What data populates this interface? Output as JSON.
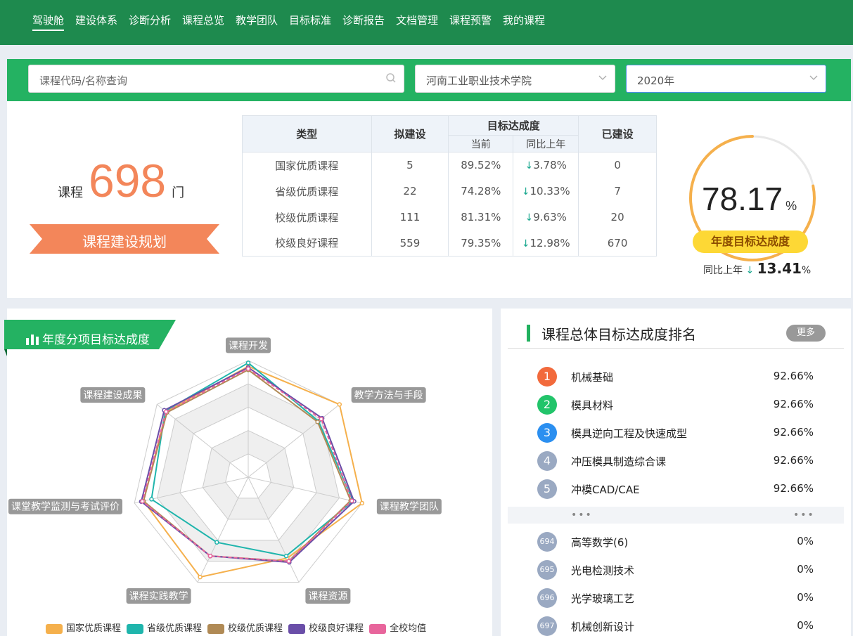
{
  "nav": {
    "items": [
      "驾驶舱",
      "建设体系",
      "诊断分析",
      "课程总览",
      "教学团队",
      "目标标准",
      "诊断报告",
      "文档管理",
      "课程预警",
      "我的课程"
    ]
  },
  "filters": {
    "search_placeholder": "课程代码/名称查询",
    "school": "河南工业职业技术学院",
    "year": "2020年"
  },
  "summary": {
    "label_prefix": "课程",
    "count": "698",
    "label_suffix": "门",
    "plan_button": "课程建设规划"
  },
  "table": {
    "headers": {
      "type": "类型",
      "planned": "拟建设",
      "goal": "目标达成度",
      "current": "当前",
      "yoy": "同比上年",
      "built": "已建设"
    },
    "rows": [
      {
        "type": "国家优质课程",
        "planned": "5",
        "current": "89.52%",
        "yoy": "3.78%",
        "built": "0"
      },
      {
        "type": "省级优质课程",
        "planned": "22",
        "current": "74.28%",
        "yoy": "10.33%",
        "built": "7"
      },
      {
        "type": "校级优质课程",
        "planned": "111",
        "current": "81.31%",
        "yoy": "9.63%",
        "built": "20"
      },
      {
        "type": "校级良好课程",
        "planned": "559",
        "current": "79.35%",
        "yoy": "12.98%",
        "built": "670"
      }
    ]
  },
  "gauge": {
    "value": "78.17",
    "unit": "%",
    "fraction": 0.7817,
    "label": "年度目标达成度",
    "yoy_label": "同比上年",
    "yoy_value": "13.41",
    "yoy_unit": "%"
  },
  "radar": {
    "title": "年度分项目标达成度"
  },
  "chart_data": {
    "type": "radar",
    "title": "年度分项目标达成度",
    "indicators": [
      "课程开发",
      "教学方法与手段",
      "课程教学团队",
      "课程资源",
      "课程实践教学",
      "课堂教学监测与考试评价",
      "课程建设成果"
    ],
    "max": 100,
    "series": [
      {
        "name": "国家优质课程",
        "color": "#f5b04c",
        "values": [
          95,
          100,
          100,
          77,
          95,
          92,
          90
        ]
      },
      {
        "name": "省级优质课程",
        "color": "#1fb5ac",
        "values": [
          98,
          77,
          92,
          75,
          62,
          85,
          91
        ]
      },
      {
        "name": "校级优质课程",
        "color": "#b08a55",
        "values": [
          92,
          76,
          90,
          80,
          75,
          92,
          89
        ]
      },
      {
        "name": "校级良好课程",
        "color": "#6a4ea8",
        "values": [
          94,
          81,
          93,
          81,
          75,
          94,
          92
        ]
      },
      {
        "name": "全校均值",
        "color": "#e8659c",
        "values": [
          93,
          80,
          91,
          80,
          75,
          93,
          90
        ]
      }
    ]
  },
  "ranking": {
    "title": "课程总体目标达成度排名",
    "more": "更多",
    "top": [
      {
        "rank": "1",
        "name": "机械基础",
        "value": "92.66%",
        "color": "#f26a3c"
      },
      {
        "rank": "2",
        "name": "模具材料",
        "value": "92.66%",
        "color": "#22c46a"
      },
      {
        "rank": "3",
        "name": "模具逆向工程及快速成型",
        "value": "92.66%",
        "color": "#2b8ff0"
      },
      {
        "rank": "4",
        "name": "冲压模具制造综合课",
        "value": "92.66%",
        "color": "#9aa9c2"
      },
      {
        "rank": "5",
        "name": "冲模CAD/CAE",
        "value": "92.66%",
        "color": "#9aa9c2"
      }
    ],
    "ellipsis": "•••",
    "bottom": [
      {
        "rank": "694",
        "name": "高等数学(6)",
        "value": "0%",
        "color": "#9aa9c2"
      },
      {
        "rank": "695",
        "name": "光电检测技术",
        "value": "0%",
        "color": "#9aa9c2"
      },
      {
        "rank": "696",
        "name": "光学玻璃工艺",
        "value": "0%",
        "color": "#9aa9c2"
      },
      {
        "rank": "697",
        "name": "机械创新设计",
        "value": "0%",
        "color": "#9aa9c2"
      }
    ]
  }
}
